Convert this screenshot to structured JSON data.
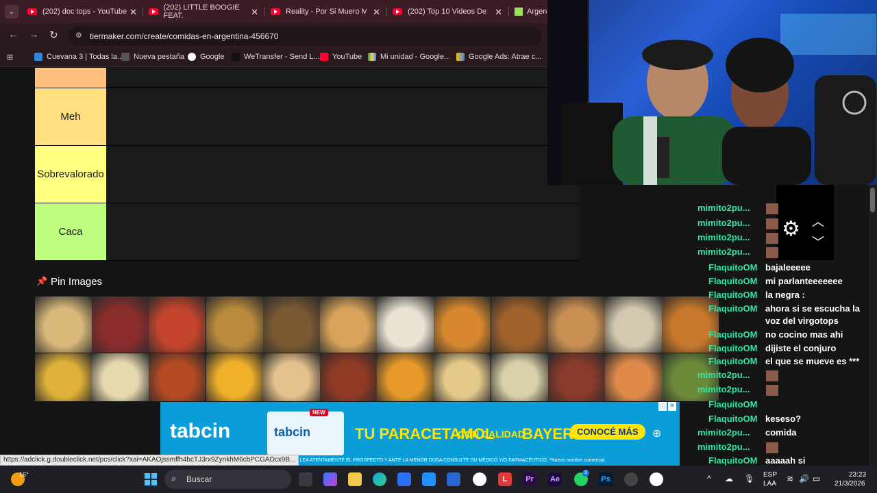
{
  "browser": {
    "tabs": [
      {
        "label": "(202) doc tops - YouTube",
        "favicon": "youtube-icon"
      },
      {
        "label": "(202) LITTLE BOOGIE FEAT.",
        "favicon": "youtube-icon"
      },
      {
        "label": "Reality - Por Si Muero Maña",
        "favicon": "youtube-icon"
      },
      {
        "label": "(202) Top 10 Videos De FAI",
        "favicon": "youtube-icon"
      },
      {
        "label": "Argen",
        "favicon": "tiermaker-icon"
      }
    ],
    "url": "tiermaker.com/create/comidas-en-argentina-456670",
    "bookmarks": [
      "Cuevana 3 | Todas la...",
      "Nueva pestaña",
      "Google",
      "WeTransfer - Send L...",
      "YouTube",
      "Mi unidad - Google...",
      "Google Ads: Atrae c..."
    ],
    "status_link": "https://adclick.g.doubleclick.net/pcs/click?xai=AKAOjssmffh4bcTJ3rx9ZynkhM6cbPCGADcx9B..."
  },
  "tierlist": {
    "tiers": [
      {
        "label": "",
        "color": "#ffbf7f"
      },
      {
        "label": "Meh",
        "color": "#ffdf7f"
      },
      {
        "label": "Sobrevalorado",
        "color": "#ffff7f"
      },
      {
        "label": "Caca",
        "color": "#bfff7f"
      }
    ],
    "pin_title": "Pin Images"
  },
  "chat": [
    {
      "user": "mimito2pu...",
      "msg": ""
    },
    {
      "user": "mimito2pu...",
      "msg": ""
    },
    {
      "user": "mimito2pu...",
      "msg": ""
    },
    {
      "user": "mimito2pu...",
      "msg": ""
    },
    {
      "user": "FlaquitoOM",
      "msg": "bajaleeeee"
    },
    {
      "user": "FlaquitoOM",
      "msg": "mi parlanteeeeeee"
    },
    {
      "user": "FlaquitoOM",
      "msg": "la negra :"
    },
    {
      "user": "FlaquitoOM",
      "msg": "ahora si se escucha la"
    },
    {
      "user": "",
      "msg": "voz del virgotops"
    },
    {
      "user": "FlaquitoOM",
      "msg": "no cocino mas ahi"
    },
    {
      "user": "FlaquitoOM",
      "msg": "dijiste el conjuro"
    },
    {
      "user": "FlaquitoOM",
      "msg": "el que se mueve es ***"
    },
    {
      "user": "mimito2pu...",
      "msg": ""
    },
    {
      "user": "mimito2pu...",
      "msg": ""
    },
    {
      "user": "FlaquitoOM",
      "msg": ""
    },
    {
      "user": "FlaquitoOM",
      "msg": "keseso?"
    },
    {
      "user": "mimito2pu...",
      "msg": "comida"
    },
    {
      "user": "mimito2pu...",
      "msg": ""
    },
    {
      "user": "FlaquitoOM",
      "msg": "aaaaah si"
    }
  ],
  "ad": {
    "brand": "tabcin",
    "pack_badge": "NEW",
    "pack_name": "tabcin",
    "headline_1": "TU PARACETAMOL",
    "headline_2": "CON CALIDAD",
    "headline_3": "BAYER",
    "cta": "CONOCÉ MÁS",
    "disclaimer": "EN. LEA ATENTAMENTE EL PROSPECTO Y ANTE LA MENOR DUDA CONSULTE SU MÉDICO Y/O FARMACÉUTICO. *Nuevo nombre comercial."
  },
  "taskbar": {
    "weather": "16°",
    "search_placeholder": "Buscar",
    "lang_1": "ESP",
    "lang_2": "LAA",
    "time": "23:23",
    "date": "21/3/2026",
    "badge_count": "9"
  }
}
